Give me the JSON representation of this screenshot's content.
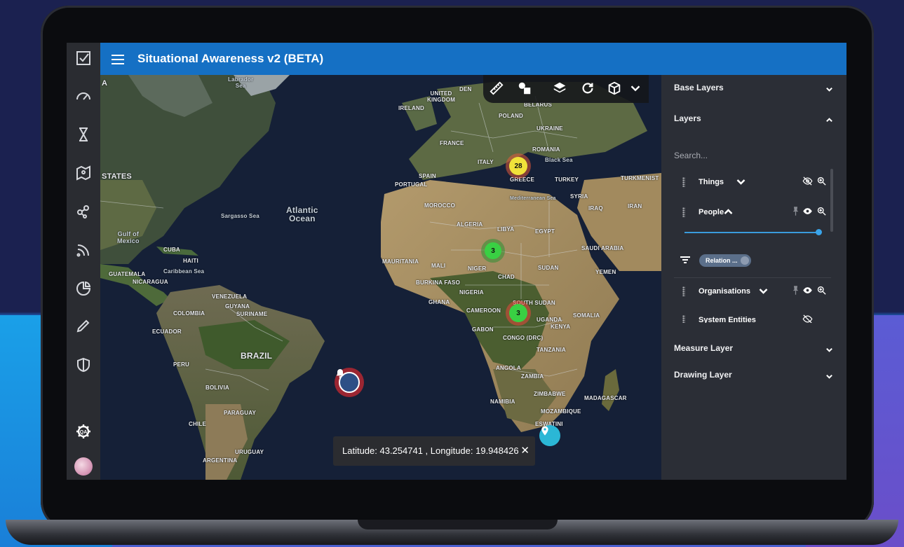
{
  "app": {
    "title": "Situational Awareness v2 (BETA)"
  },
  "rail": {
    "items": [
      {
        "icon": "task-check-icon"
      },
      {
        "icon": "dashboard-gauge-icon"
      },
      {
        "icon": "hourglass-icon"
      },
      {
        "icon": "map-icon"
      },
      {
        "icon": "network-nodes-icon"
      },
      {
        "icon": "rss-feed-icon"
      },
      {
        "icon": "pie-chart-icon"
      },
      {
        "icon": "pencil-edit-icon"
      },
      {
        "icon": "shield-icon"
      }
    ],
    "settings_badge": "QA"
  },
  "map": {
    "labels": {
      "states": "STATES",
      "gulf_mexico": "Gulf of\nMexico",
      "sargasso": "Sargasso Sea",
      "atlantic": "Atlantic\nOcean",
      "cuba": "CUBA",
      "haiti": "HAITI",
      "caribbean": "Caribbean Sea",
      "guatemala": "GUATEMALA",
      "nicaragua": "NICARAGUA",
      "venezuela": "VENEZUELA",
      "colombia": "COLOMBIA",
      "guyana": "GUYANA",
      "suriname": "SURINAME",
      "ecuador": "ECUADOR",
      "peru": "PERU",
      "brazil": "BRAZIL",
      "bolivia": "BOLIVIA",
      "paraguay": "PARAGUAY",
      "chile": "CHILE",
      "uruguay": "URUGUAY",
      "argentina": "ARGENTINA",
      "labrador": "Labrador\nSea",
      "uk": "UNITED\nKINGDOM",
      "ireland": "IRELAND",
      "den": "DEN",
      "belarus": "BELARUS",
      "poland": "POLAND",
      "ukraine": "UKRAINE",
      "france": "FRANCE",
      "romania": "ROMANIA",
      "italy": "ITALY",
      "black_sea": "Black Sea",
      "spain": "SPAIN",
      "portugal": "PORTUGAL",
      "greece": "GREECE",
      "turkey": "TURKEY",
      "turkmenistan": "TURKMENIST",
      "syria": "SYRIA",
      "iraq": "IRAQ",
      "iran": "IRAN",
      "mediterranean": "Mediterranean Sea",
      "morocco": "MOROCCO",
      "algeria": "ALGERIA",
      "libya": "LIBYA",
      "egypt": "EGYPT",
      "saudi": "SAUDI ARABIA",
      "mauritania": "MAURITANIA",
      "mali": "MALI",
      "niger": "NIGER",
      "chad": "CHAD",
      "sudan": "SUDAN",
      "yemen": "YEMEN",
      "burkina": "BURKINA FASO",
      "nigeria": "NIGERIA",
      "ghana": "GHANA",
      "cameroon": "CAMEROON",
      "south_sudan": "SOUTH SUDAN",
      "somalia": "SOMALIA",
      "gabon": "GABON",
      "uganda": "UGANDA",
      "kenya": "KENYA",
      "congo": "CONGO (DRC)",
      "tanzania": "TANZANIA",
      "angola": "ANGOLA",
      "zambia": "ZAMBIA",
      "namibia": "NAMIBIA",
      "zimbabwe": "ZIMBABWE",
      "madagascar": "MADAGASCAR",
      "mozambique": "MOZAMBIQUE",
      "eswatini": "ESWATINI",
      "edge_a": "A"
    },
    "clusters": [
      {
        "count": "28",
        "color": "#f1e23a",
        "ring": "#e25a3a"
      },
      {
        "count": "3",
        "color": "#39d043",
        "ring": "#2f8f35"
      },
      {
        "count": "3",
        "color": "#39d043",
        "ring": "#d94a3a"
      }
    ],
    "markers": {
      "alarm_icon": "bell-alarm-icon",
      "pin_icon": "location-pin-icon"
    },
    "toolbar": [
      {
        "icon": "ruler-icon"
      },
      {
        "icon": "shapes-icon"
      },
      {
        "icon": "layers-icon"
      },
      {
        "icon": "refresh-icon"
      },
      {
        "icon": "cube-3d-icon"
      },
      {
        "icon": "chevron-down-icon"
      }
    ],
    "coordinates": "Latitude: 43.254741 , Longitude: 19.948426",
    "coordinates_close": "✕"
  },
  "panel": {
    "base_layers": "Base Layers",
    "layers": "Layers",
    "search_placeholder": "Search...",
    "items": [
      {
        "name": "Things",
        "visible": false
      },
      {
        "name": "People",
        "visible": true,
        "expanded": true
      },
      {
        "name": "Organisations",
        "visible": true
      },
      {
        "name": "System Entities",
        "visible": false
      }
    ],
    "people_slider": 1.0,
    "filter_chip": "Relation ...",
    "measure_layer": "Measure Layer",
    "drawing_layer": "Drawing Layer"
  },
  "colors": {
    "header": "#1570c4",
    "rail": "#2a2c31",
    "panel": "#2b2e36",
    "accent": "#3aa4ea"
  }
}
